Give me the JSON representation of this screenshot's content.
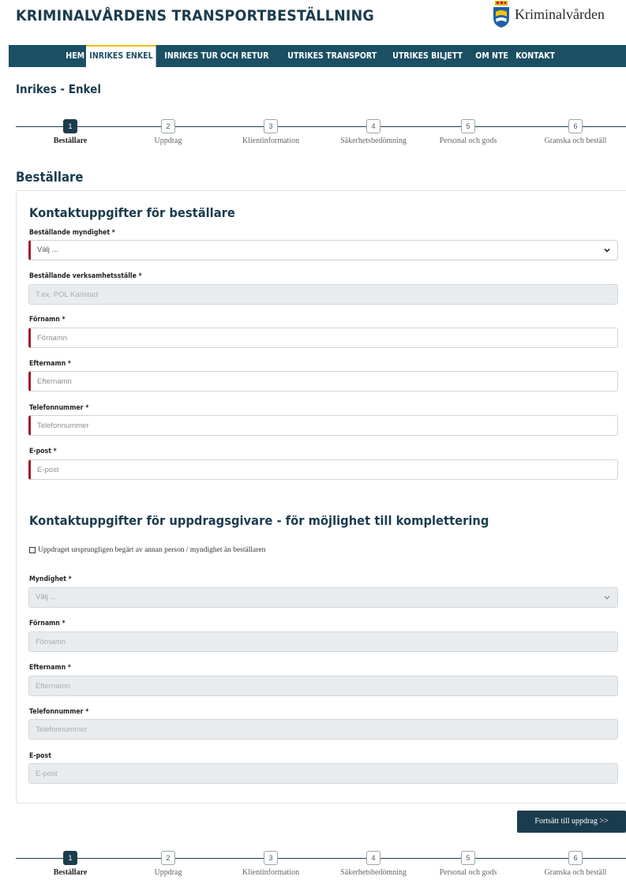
{
  "header": {
    "site_title": "KRIMINALVÅRDENS TRANSPORTBESTÄLLNING",
    "logo_text": "Kriminalvården"
  },
  "nav": {
    "items": [
      {
        "label": "HEM",
        "active": false
      },
      {
        "label": "INRIKES ENKEL",
        "active": true
      },
      {
        "label": "INRIKES TUR OCH RETUR",
        "active": false
      },
      {
        "label": "UTRIKES TRANSPORT",
        "active": false
      },
      {
        "label": "UTRIKES BILJETT",
        "active": false
      },
      {
        "label": "OM NTE",
        "active": false
      },
      {
        "label": "KONTAKT",
        "active": false
      }
    ]
  },
  "page": {
    "heading": "Inrikes - Enkel",
    "section_heading": "Beställare"
  },
  "steps": [
    {
      "num": "1",
      "label": "Beställare",
      "active": true
    },
    {
      "num": "2",
      "label": "Uppdrag",
      "active": false
    },
    {
      "num": "3",
      "label": "Klientinformation",
      "active": false
    },
    {
      "num": "4",
      "label": "Säkerhetsbedömning",
      "active": false
    },
    {
      "num": "5",
      "label": "Personal och gods",
      "active": false
    },
    {
      "num": "6",
      "label": "Granska och beställ",
      "active": false
    }
  ],
  "orderer": {
    "heading": "Kontaktuppgifter för beställare",
    "authority": {
      "label": "Beställande myndighet *",
      "value": "Välj ..."
    },
    "unit": {
      "label": "Beställande verksamhetsställe *",
      "placeholder": "T.ex. POL Karlstad"
    },
    "first_name": {
      "label": "Förnamn *",
      "placeholder": "Förnamn"
    },
    "last_name": {
      "label": "Efternamn *",
      "placeholder": "Efternamn"
    },
    "phone": {
      "label": "Telefonnummer *",
      "placeholder": "Telefonnummer"
    },
    "email": {
      "label": "E-post *",
      "placeholder": "E-post"
    }
  },
  "client": {
    "heading": "Kontaktuppgifter för uppdragsgivare - för möjlighet till komplettering",
    "checkbox_label": "Uppdraget ursprungligen begärt av annan person / myndighet än beställaren",
    "checkbox_checked": false,
    "authority": {
      "label": "Myndighet *",
      "value": "Välj ..."
    },
    "first_name": {
      "label": "Förnamn *",
      "placeholder": "Förnamn"
    },
    "last_name": {
      "label": "Efternamn *",
      "placeholder": "Efternamn"
    },
    "phone": {
      "label": "Telefonnummer *",
      "placeholder": "Telefonnummer"
    },
    "email": {
      "label": "E-post",
      "placeholder": "E-post"
    }
  },
  "actions": {
    "continue_label": "Fortsätt till uppdrag >>"
  },
  "colors": {
    "navy": "#1b3c4e",
    "nav_bg": "#1b4f63",
    "required_marker": "#a3192e",
    "active_tab_border": "#f0c000"
  }
}
